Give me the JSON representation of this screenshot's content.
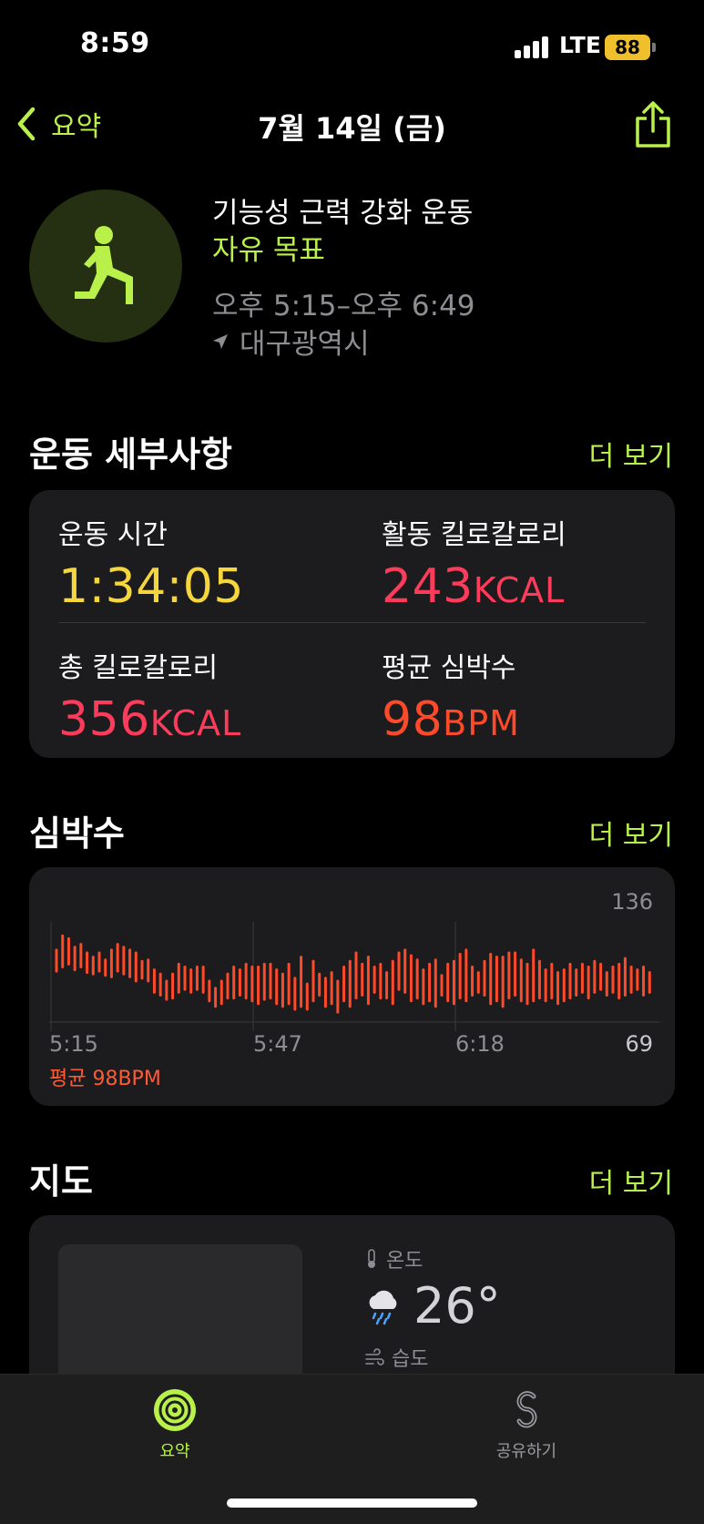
{
  "status_bar": {
    "time": "8:59",
    "network": "LTE",
    "battery": "88"
  },
  "nav": {
    "back_label": "요약",
    "title": "7월 14일 (금)"
  },
  "workout": {
    "name": "기능성 근력 강화 운동",
    "goal": "자유 목표",
    "time_range": "오후 5:15–오후 6:49",
    "location": "대구광역시"
  },
  "details": {
    "title": "운동 세부사항",
    "more": "더 보기",
    "metrics": [
      {
        "label": "운동 시간",
        "value": "1:34:05",
        "unit": "",
        "color": "#f5d63c"
      },
      {
        "label": "활동 킬로칼로리",
        "value": "243",
        "unit": "KCAL",
        "color": "#ff3b5c"
      },
      {
        "label": "총 킬로칼로리",
        "value": "356",
        "unit": "KCAL",
        "color": "#ff3b5c"
      },
      {
        "label": "평균 심박수",
        "value": "98",
        "unit": "BPM",
        "color": "#ff4a2a"
      }
    ]
  },
  "heart_rate": {
    "title": "심박수",
    "more": "더 보기",
    "max": "136",
    "min": "69",
    "x_labels": [
      "5:15",
      "5:47",
      "6:18"
    ],
    "average": "평균 98BPM",
    "color": "#ff4a2a"
  },
  "chart_data": {
    "type": "bar",
    "title": "",
    "ylim": [
      69,
      136
    ],
    "x_ticks": [
      "5:15",
      "5:47",
      "6:18"
    ],
    "ranges": [
      [
        105,
        120
      ],
      [
        108,
        130
      ],
      [
        110,
        128
      ],
      [
        106,
        122
      ],
      [
        108,
        124
      ],
      [
        104,
        118
      ],
      [
        103,
        115
      ],
      [
        105,
        118
      ],
      [
        102,
        113
      ],
      [
        101,
        120
      ],
      [
        105,
        124
      ],
      [
        103,
        122
      ],
      [
        101,
        120
      ],
      [
        98,
        118
      ],
      [
        100,
        112
      ],
      [
        98,
        113
      ],
      [
        90,
        106
      ],
      [
        88,
        103
      ],
      [
        85,
        98
      ],
      [
        86,
        103
      ],
      [
        90,
        110
      ],
      [
        92,
        108
      ],
      [
        90,
        106
      ],
      [
        92,
        108
      ],
      [
        90,
        108
      ],
      [
        84,
        98
      ],
      [
        80,
        93
      ],
      [
        82,
        98
      ],
      [
        86,
        103
      ],
      [
        86,
        108
      ],
      [
        88,
        106
      ],
      [
        86,
        110
      ],
      [
        84,
        108
      ],
      [
        82,
        108
      ],
      [
        85,
        110
      ],
      [
        86,
        110
      ],
      [
        82,
        106
      ],
      [
        80,
        103
      ],
      [
        82,
        110
      ],
      [
        78,
        100
      ],
      [
        80,
        115
      ],
      [
        78,
        96
      ],
      [
        84,
        112
      ],
      [
        88,
        103
      ],
      [
        80,
        100
      ],
      [
        82,
        104
      ],
      [
        76,
        98
      ],
      [
        84,
        108
      ],
      [
        80,
        112
      ],
      [
        86,
        118
      ],
      [
        88,
        110
      ],
      [
        82,
        115
      ],
      [
        90,
        108
      ],
      [
        86,
        110
      ],
      [
        86,
        104
      ],
      [
        82,
        112
      ],
      [
        92,
        118
      ],
      [
        90,
        120
      ],
      [
        84,
        116
      ],
      [
        86,
        113
      ],
      [
        82,
        106
      ],
      [
        84,
        110
      ],
      [
        80,
        113
      ],
      [
        88,
        102
      ],
      [
        84,
        110
      ],
      [
        82,
        112
      ],
      [
        86,
        117
      ],
      [
        84,
        120
      ],
      [
        88,
        108
      ],
      [
        90,
        104
      ],
      [
        88,
        112
      ],
      [
        82,
        117
      ],
      [
        84,
        115
      ],
      [
        80,
        115
      ],
      [
        86,
        118
      ],
      [
        88,
        118
      ],
      [
        84,
        113
      ],
      [
        82,
        110
      ],
      [
        84,
        120
      ],
      [
        86,
        112
      ],
      [
        84,
        106
      ],
      [
        86,
        110
      ],
      [
        82,
        104
      ],
      [
        84,
        106
      ],
      [
        86,
        110
      ],
      [
        88,
        106
      ],
      [
        90,
        110
      ],
      [
        86,
        108
      ],
      [
        90,
        112
      ],
      [
        92,
        110
      ],
      [
        88,
        104
      ],
      [
        90,
        108
      ],
      [
        86,
        110
      ],
      [
        88,
        114
      ],
      [
        90,
        108
      ],
      [
        92,
        106
      ],
      [
        88,
        108
      ],
      [
        90,
        104
      ]
    ]
  },
  "map": {
    "title": "지도",
    "more": "더 보기",
    "temp_label": "온도",
    "temperature": "26°",
    "humidity_label": "습도"
  },
  "tabbar": {
    "tabs": [
      {
        "label": "요약",
        "icon": "activity-rings-icon",
        "active": true
      },
      {
        "label": "공유하기",
        "icon": "sharing-icon",
        "active": false
      }
    ]
  },
  "colors": {
    "accent": "#b9f14a",
    "move": "#ff3b5c",
    "time": "#f5d63c",
    "heart": "#ff4a2a"
  }
}
